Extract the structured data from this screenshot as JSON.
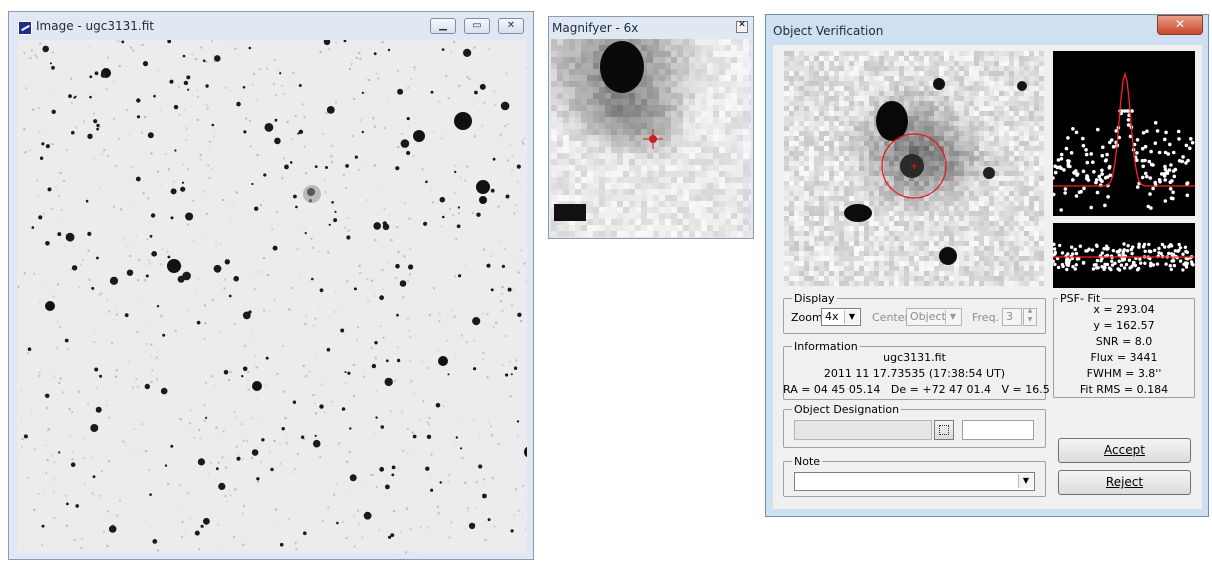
{
  "image_window": {
    "title": "Image - ugc3131.fit",
    "app_icon": "telescope-icon",
    "controls": {
      "minimize": "minimize-icon",
      "maximize": "maximize-icon",
      "close": "close-icon"
    }
  },
  "magnifier_window": {
    "title": "Magnifyer - 6x",
    "controls": {
      "close": "close-icon"
    }
  },
  "verify_window": {
    "title": "Object Verification",
    "controls": {
      "close": "close-icon"
    },
    "display": {
      "legend": "Display",
      "zoom_label": "Zoom",
      "zoom_value": "4x",
      "center_label": "Center",
      "center_value": "Object",
      "freq_label": "Freq.",
      "freq_value": "3"
    },
    "psf": {
      "legend": "PSF- Fit",
      "lines": [
        "x = 293.04",
        "y = 162.57",
        "SNR = 8.0",
        "Flux = 3441",
        "FWHM = 3.8''",
        "Fit RMS = 0.184"
      ]
    },
    "information": {
      "legend": "Information",
      "filename": "ugc3131.fit",
      "datetime": "2011 11 17.73535 (17:38:54 UT)",
      "coords": "RA = 04 45 05.14   De = +72 47 01.4   V = 16.5"
    },
    "designation": {
      "legend": "Object Designation",
      "browse_icon": "browse-icon"
    },
    "note": {
      "legend": "Note",
      "value": ""
    },
    "buttons": {
      "accept": "Accept",
      "reject": "Reject"
    },
    "colors": {
      "fit_curve": "#ff2020",
      "aperture": "#ee1111"
    }
  }
}
